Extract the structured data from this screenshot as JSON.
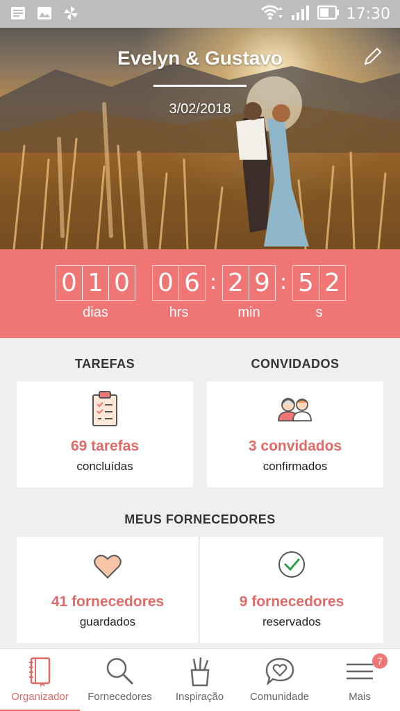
{
  "status_bar": {
    "time": "17:30"
  },
  "hero": {
    "title": "Evelyn & Gustavo",
    "date": "3/02/2018"
  },
  "countdown": {
    "days": [
      "0",
      "1",
      "0"
    ],
    "hours": [
      "0",
      "6"
    ],
    "minutes": [
      "2",
      "9"
    ],
    "seconds": [
      "5",
      "2"
    ],
    "separator": ":",
    "labels": {
      "days": "dias",
      "hours": "hrs",
      "minutes": "min",
      "seconds": "s"
    }
  },
  "tasks": {
    "title": "TAREFAS",
    "count": "69 tarefas",
    "status": "concluídas"
  },
  "guests": {
    "title": "CONVIDADOS",
    "count": "3 convidados",
    "status": "confirmados"
  },
  "vendors": {
    "title": "MEUS FORNECEDORES",
    "saved": {
      "count": "41 fornecedores",
      "status": "guardados"
    },
    "booked": {
      "count": "9 fornecedores",
      "status": "reservados"
    }
  },
  "bottom_nav": {
    "items": [
      {
        "label": "Organizador",
        "icon": "notebook-icon",
        "active": true
      },
      {
        "label": "Fornecedores",
        "icon": "search-icon"
      },
      {
        "label": "Inspiração",
        "icon": "cup-pencils-icon"
      },
      {
        "label": "Comunidade",
        "icon": "heart-chat-icon"
      },
      {
        "label": "Mais",
        "icon": "menu-icon",
        "badge": "7"
      }
    ]
  },
  "colors": {
    "accent": "#f07575",
    "accent_text": "#e06a66",
    "background": "#efefef"
  }
}
